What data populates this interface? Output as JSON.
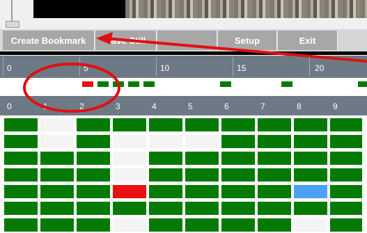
{
  "toolbar": {
    "buttons": [
      {
        "label": "Create Bookmark"
      },
      {
        "label": "Save Still"
      },
      {
        "label": ""
      },
      {
        "label": "Setup"
      },
      {
        "label": "Exit"
      }
    ]
  },
  "ruler": {
    "labels": [
      "0",
      "5",
      "10",
      "15",
      "20"
    ]
  },
  "grid": {
    "columns": [
      "0",
      "1",
      "2",
      "3",
      "4",
      "5",
      "6",
      "7",
      "8",
      "9"
    ],
    "rows": [
      [
        "g",
        "e",
        "g",
        "g",
        "g",
        "g",
        "g",
        "g",
        "g",
        "g"
      ],
      [
        "g",
        "e",
        "g",
        "e",
        "e",
        "e",
        "g",
        "g",
        "g",
        "g"
      ],
      [
        "g",
        "g",
        "g",
        "e",
        "g",
        "g",
        "g",
        "g",
        "g",
        "g"
      ],
      [
        "g",
        "g",
        "g",
        "e",
        "g",
        "g",
        "g",
        "g",
        "g",
        "g"
      ],
      [
        "g",
        "g",
        "g",
        "r",
        "g",
        "g",
        "g",
        "g",
        "b",
        "g"
      ],
      [
        "g",
        "g",
        "g",
        "g",
        "g",
        "g",
        "g",
        "g",
        "g",
        "g"
      ],
      [
        "g",
        "g",
        "g",
        "e",
        "g",
        "g",
        "g",
        "g",
        "e",
        "g"
      ]
    ]
  },
  "colors": {
    "green": "#047a04",
    "red": "#e81212",
    "blue": "#4ea0f2",
    "empty": "#f4f4f4",
    "annotation": "#e01010"
  }
}
